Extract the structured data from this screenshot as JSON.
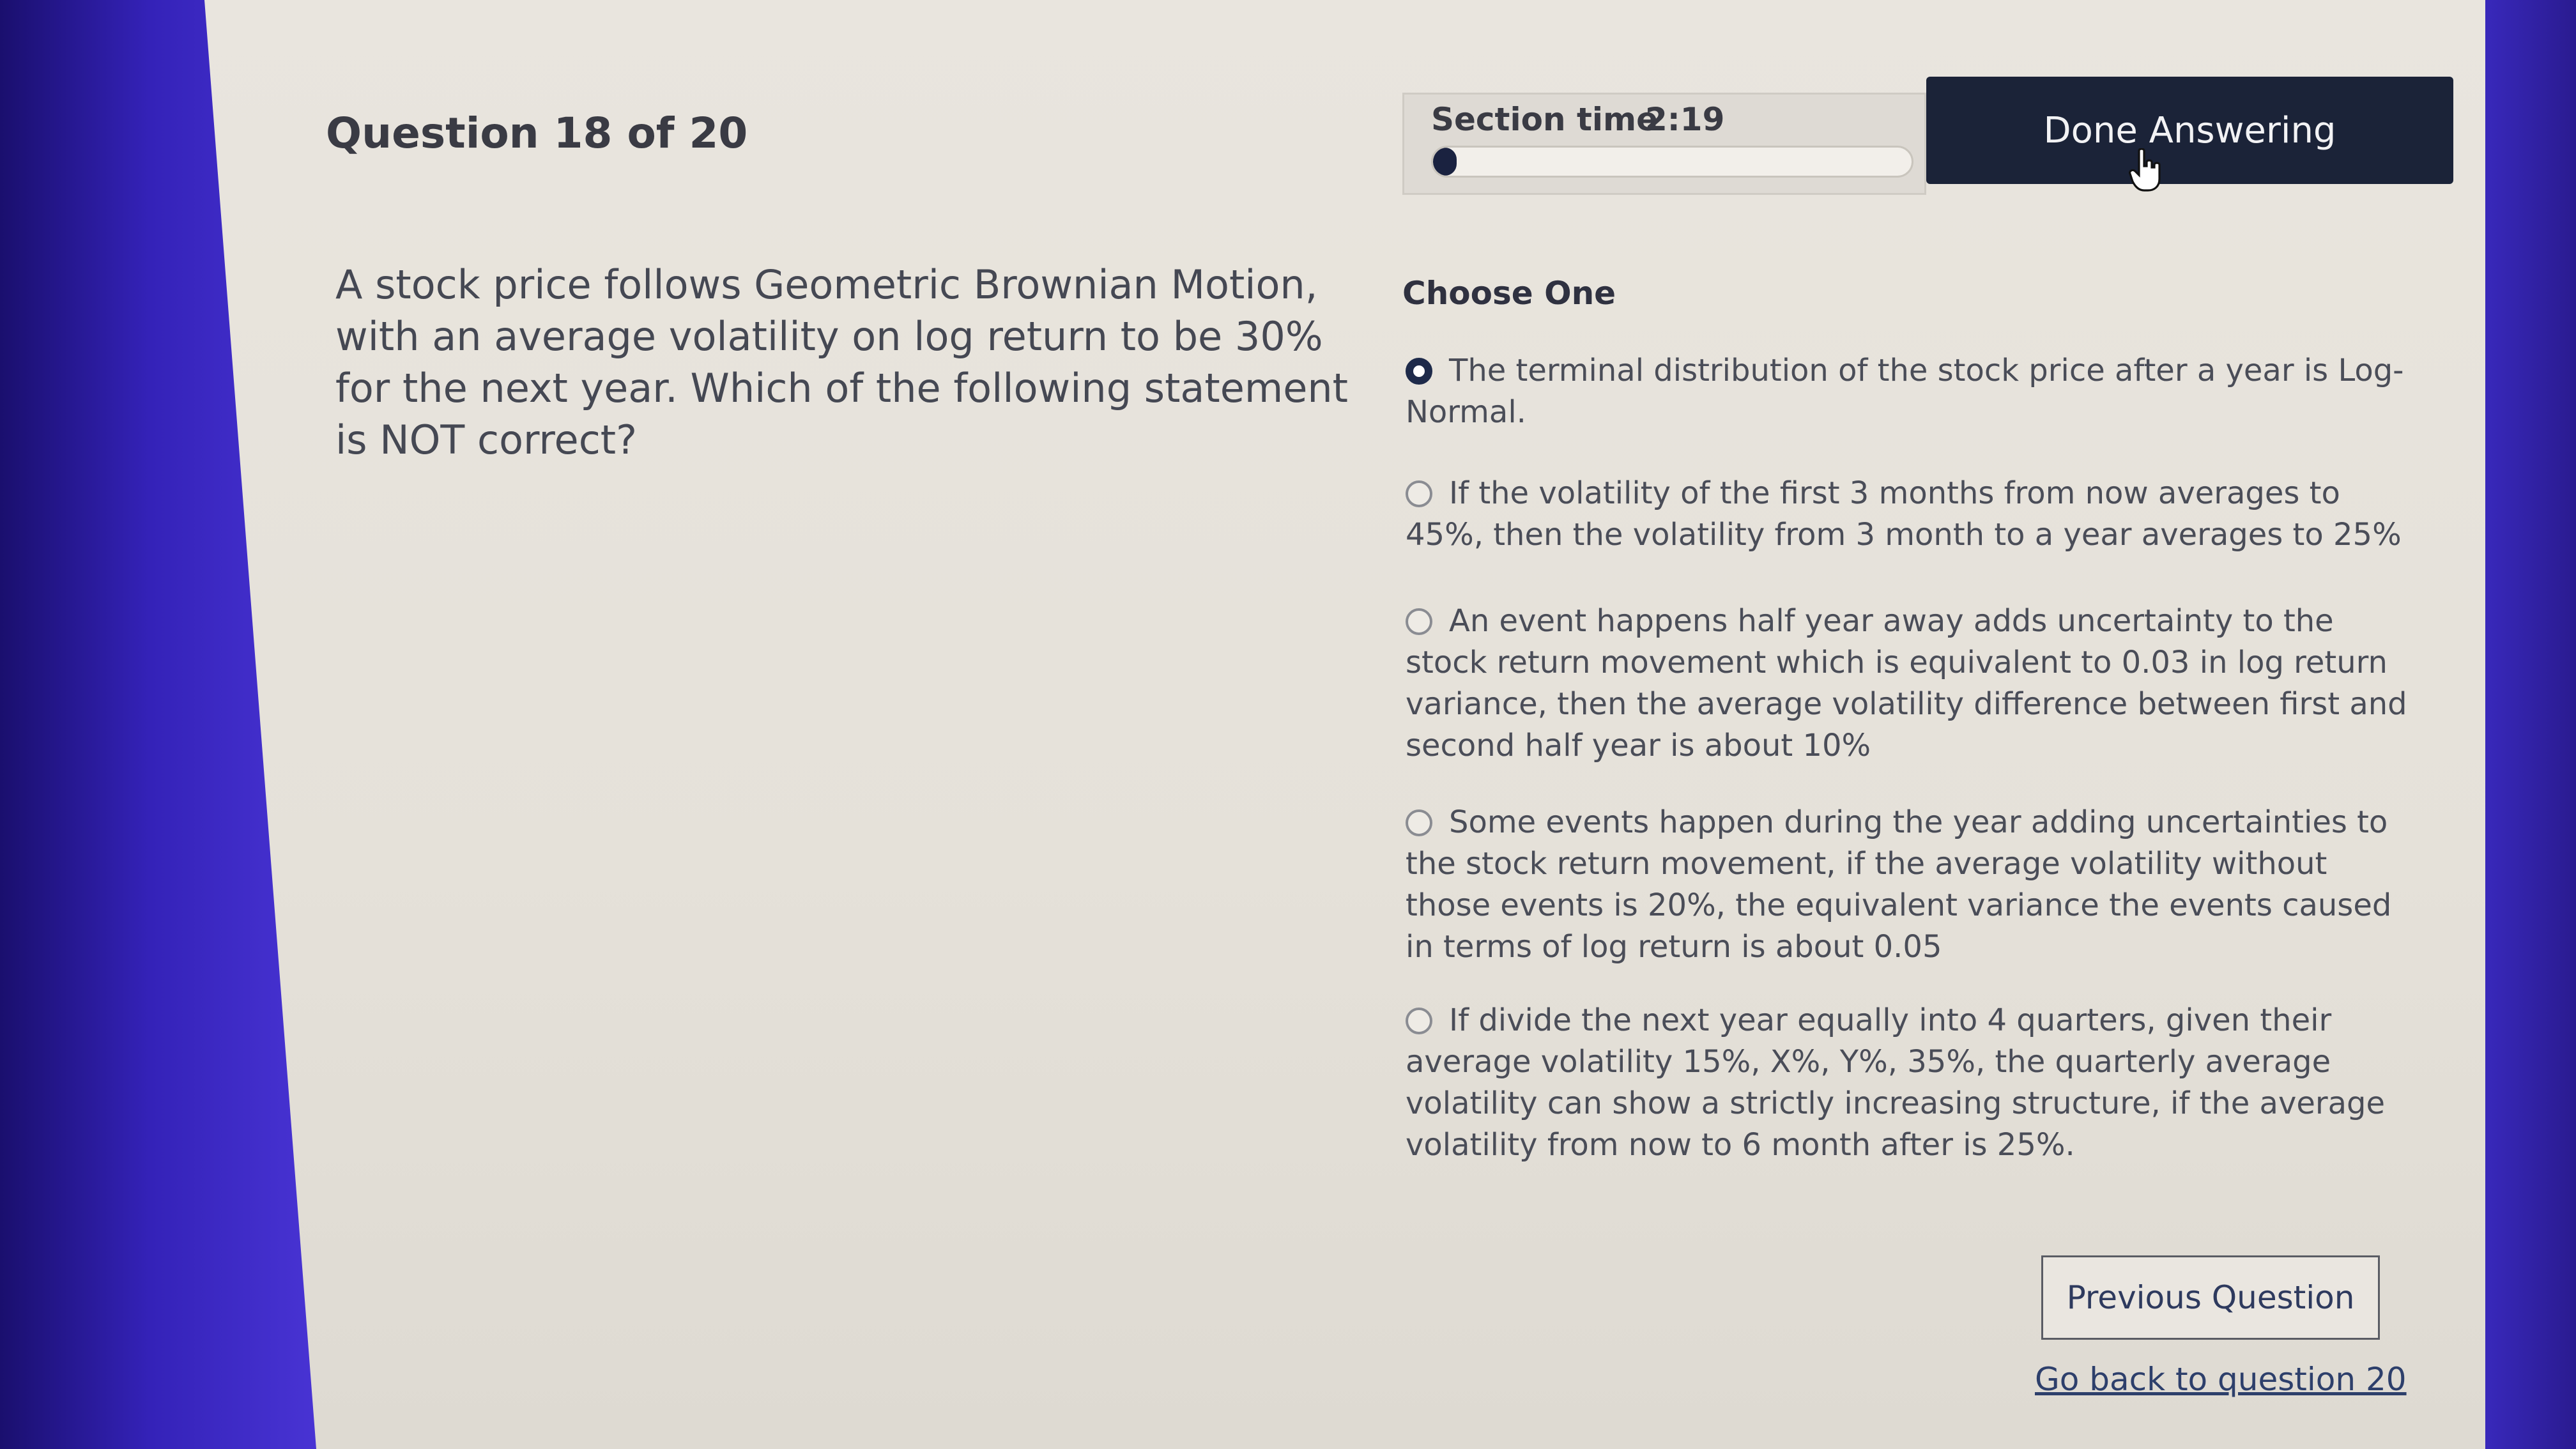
{
  "header": {
    "question_counter": "Question 18 of 20",
    "section_time_label": "Section time",
    "section_time_value": "2:19",
    "section_time_progress_fraction": 0.05,
    "done_button_label": "Done Answering"
  },
  "question": {
    "text": "A stock price follows Geometric Brownian Motion, with an average volatility on log return to be 30% for the next year. Which of the following statement is NOT correct?"
  },
  "answers": {
    "heading": "Choose One",
    "options": [
      {
        "text": "The terminal distribution of the stock price after a year is Log-Normal.",
        "selected": true
      },
      {
        "text": "If the volatility of the first 3 months from now averages to 45%, then the volatility from 3 month to a year averages to 25%",
        "selected": false
      },
      {
        "text": "An event happens half year away adds uncertainty to the stock return movement which is equivalent to 0.03 in log return variance, then the average volatility difference between first and second half year is about 10%",
        "selected": false
      },
      {
        "text": "Some events happen during the year adding uncertainties to the stock return movement, if the average volatility without those events is 20%, the equivalent variance the events caused in terms of log return is about 0.05",
        "selected": false
      },
      {
        "text": "If divide the next year equally into 4 quarters, given their average volatility 15%, X%, Y%, 35%, the quarterly average volatility can show a strictly increasing structure, if the average volatility from now to 6 month after is 25%.",
        "selected": false
      }
    ]
  },
  "footer": {
    "previous_button_label": "Previous Question",
    "go_back_link_label": "Go back to question 20"
  },
  "colors": {
    "accent_dark": "#1b2338",
    "screen_background": "#e9e5de",
    "bezel": "#2a1b8c"
  }
}
